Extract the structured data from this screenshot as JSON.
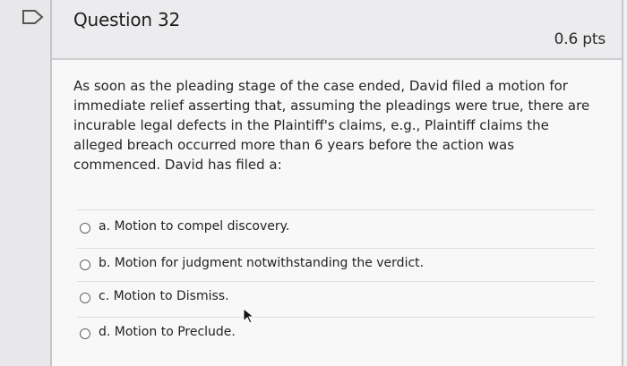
{
  "question": {
    "title": "Question 32",
    "points": "0.6 pts",
    "text": "As soon as the pleading stage of the case ended, David filed a motion for immediate relief asserting that, assuming the pleadings were true, there are incurable legal defects in the Plaintiff's claims, e.g., Plaintiff claims the alleged breach occurred more than 6 years before the action was commenced.  David has filed a:"
  },
  "answers": [
    {
      "label": "a. Motion to compel discovery."
    },
    {
      "label": "b. Motion for judgment notwithstanding the verdict."
    },
    {
      "label": "c. Motion to Dismiss."
    },
    {
      "label": "d. Motion to Preclude."
    }
  ],
  "icons": {
    "flag": "flag-icon",
    "cursor": "cursor-icon",
    "radio": "radio-button"
  },
  "colors": {
    "page_background": "#f1f1f2",
    "header_background": "#ececee",
    "text": "#262626",
    "border": "#c5c6c9"
  }
}
